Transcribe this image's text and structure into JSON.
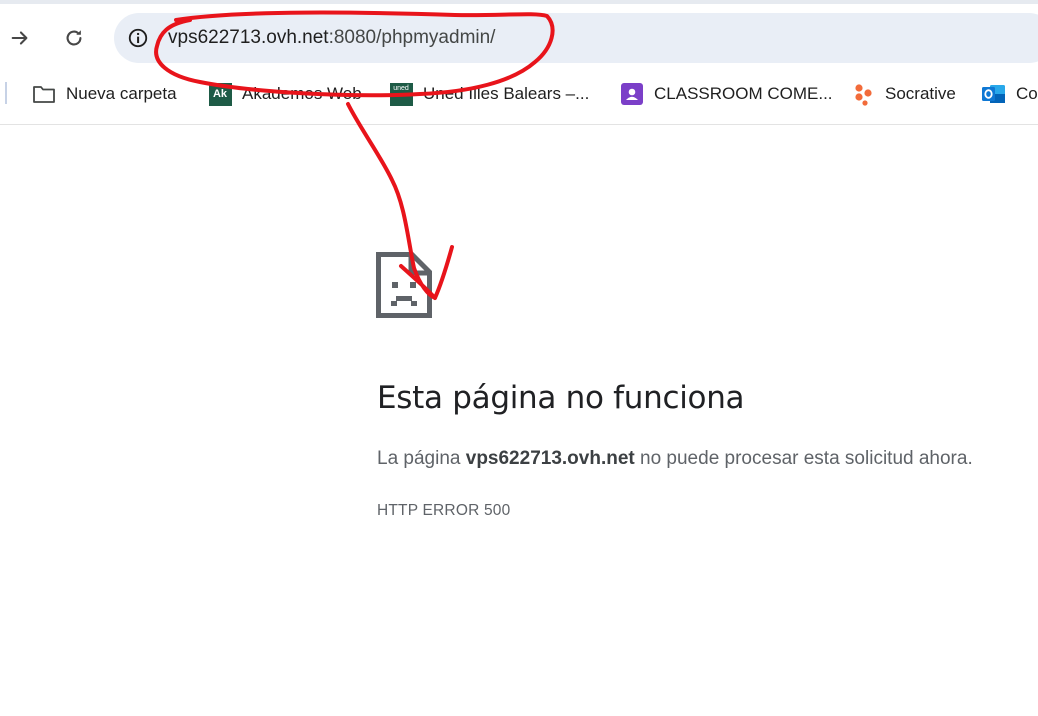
{
  "toolbar": {
    "forward_icon": "arrow-right-icon",
    "reload_icon": "reload-icon",
    "site_info_icon": "info-icon",
    "url_host": "vps622713.ovh.net",
    "url_rest": ":8080/phpmyadmin/"
  },
  "bookmarks": [
    {
      "label": "Nueva carpeta",
      "icon": "folder-icon"
    },
    {
      "label": "Akademos Web",
      "icon": "akademos-icon",
      "icon_text": "Ak"
    },
    {
      "label": "Uned Illes Balears –...",
      "icon": "uned-icon",
      "icon_text": "uned"
    },
    {
      "label": "CLASSROOM COME...",
      "icon": "google-classroom-icon"
    },
    {
      "label": "Socrative",
      "icon": "socrative-icon"
    },
    {
      "label": "Co",
      "icon": "outlook-icon"
    }
  ],
  "error": {
    "icon": "sad-page-icon",
    "title": "Esta página no funciona",
    "desc_prefix": "La página ",
    "desc_host": "vps622713.ovh.net",
    "desc_suffix": " no puede procesar esta solicitud ahora.",
    "code": "HTTP ERROR 500"
  },
  "colors": {
    "omnibox_bg": "#e9eef6",
    "annotation": "#e8141b",
    "title": "#202124",
    "secondary_text": "#5f6368"
  }
}
